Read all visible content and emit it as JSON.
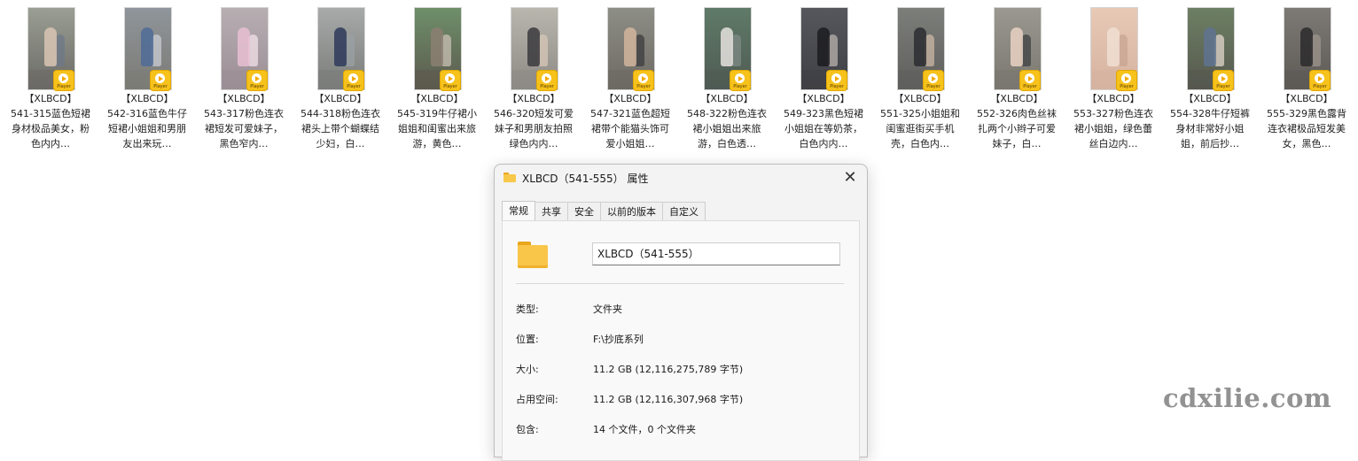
{
  "files": [
    {
      "brand": "【XLBCD】",
      "desc": "541-315蓝色短裙身材极品美女，粉色内内…",
      "scene": "#9a9e93",
      "figure": "#d9c4b3",
      "figure2": "#6d7888",
      "ground": "#6b6a66"
    },
    {
      "brand": "【XLBCD】",
      "desc": "542-316蓝色牛仔短裙小姐姐和男朋友出来玩…",
      "scene": "#8f959a",
      "figure": "#4f6b96",
      "figure2": "#c9ccd3",
      "ground": "#7c7b76"
    },
    {
      "brand": "【XLBCD】",
      "desc": "543-317粉色连衣裙短发可爱妹子，黑色窄内…",
      "scene": "#b7aeb2",
      "figure": "#e7bfd2",
      "figure2": "#f2e1e8",
      "ground": "#9b8e95"
    },
    {
      "brand": "【XLBCD】",
      "desc": "544-318粉色连衣裙头上带个蝴蝶结少妇，白…",
      "scene": "#a8aaa9",
      "figure": "#2e3a5a",
      "figure2": "#9aa0a4",
      "ground": "#7a7c7a"
    },
    {
      "brand": "【XLBCD】",
      "desc": "545-319牛仔裙小姐姐和闺蜜出来旅游，黄色…",
      "scene": "#6e8f6a",
      "figure": "#8c7f72",
      "figure2": "#cac2b4",
      "ground": "#5c5a4e"
    },
    {
      "brand": "【XLBCD】",
      "desc": "546-320短发可爱妹子和男朋友拍照绿色内内…",
      "scene": "#b9b6ae",
      "figure": "#3b3a3d",
      "figure2": "#d8c8b8",
      "ground": "#8d8a85"
    },
    {
      "brand": "【XLBCD】",
      "desc": "547-321蓝色超短裙带个能猫头饰可爱小姐姐…",
      "scene": "#8d8e86",
      "figure": "#d2b59d",
      "figure2": "#3c3c3f",
      "ground": "#6d6a63"
    },
    {
      "brand": "【XLBCD】",
      "desc": "548-322粉色连衣裙小姐姐出来旅游，白色透…",
      "scene": "#5f7a68",
      "figure": "#e6e2de",
      "figure2": "#7f8b86",
      "ground": "#4f5b53"
    },
    {
      "brand": "【XLBCD】",
      "desc": "549-323黑色短裙小姐姐在等奶茶，白色内内…",
      "scene": "#55575d",
      "figure": "#1c1c20",
      "figure2": "#b9b2ad",
      "ground": "#3f4045"
    },
    {
      "brand": "【XLBCD】",
      "desc": "551-325小姐姐和闺蜜逛街买手机壳，白色内…",
      "scene": "#7c7e7a",
      "figure": "#2c2d31",
      "figure2": "#cbb7a6",
      "ground": "#5f5f5c"
    },
    {
      "brand": "【XLBCD】",
      "desc": "552-326肉色丝袜扎两个小辫子可爱妹子，白…",
      "scene": "#9a9890",
      "figure": "#e9d2c3",
      "figure2": "#404044",
      "ground": "#7a776f"
    },
    {
      "brand": "【XLBCD】",
      "desc": "553-327粉色连衣裙小姐姐，绿色蕾丝白边内…",
      "scene": "#e7c9b6",
      "figure": "#f1dfd2",
      "figure2": "#c8a493",
      "ground": "#d6b3a0"
    },
    {
      "brand": "【XLBCD】",
      "desc": "554-328牛仔短裤身材非常好小姐姐，前后抄…",
      "scene": "#6d7f63",
      "figure": "#5f7391",
      "figure2": "#e2d7cc",
      "ground": "#56584f"
    },
    {
      "brand": "【XLBCD】",
      "desc": "555-329黑色露背连衣裙极品短发美女，黑色…",
      "scene": "#7d7a76",
      "figure": "#2b2a2c",
      "figure2": "#9e968d",
      "ground": "#5d5a56"
    }
  ],
  "player_badge_text": "Player",
  "dialog": {
    "title": "XLBCD（541-555） 属性",
    "close_glyph": "✕",
    "tabs": [
      "常规",
      "共享",
      "安全",
      "以前的版本",
      "自定义"
    ],
    "name_value": "XLBCD（541-555）",
    "properties": [
      {
        "key": "类型:",
        "value": "文件夹"
      },
      {
        "key": "位置:",
        "value": "F:\\抄底系列"
      },
      {
        "key": "大小:",
        "value": "11.2 GB (12,116,275,789 字节)"
      },
      {
        "key": "占用空间:",
        "value": "11.2 GB (12,116,307,968 字节)"
      },
      {
        "key": "包含:",
        "value": "14 个文件，0 个文件夹"
      }
    ]
  },
  "watermark": "cdxilie.com"
}
